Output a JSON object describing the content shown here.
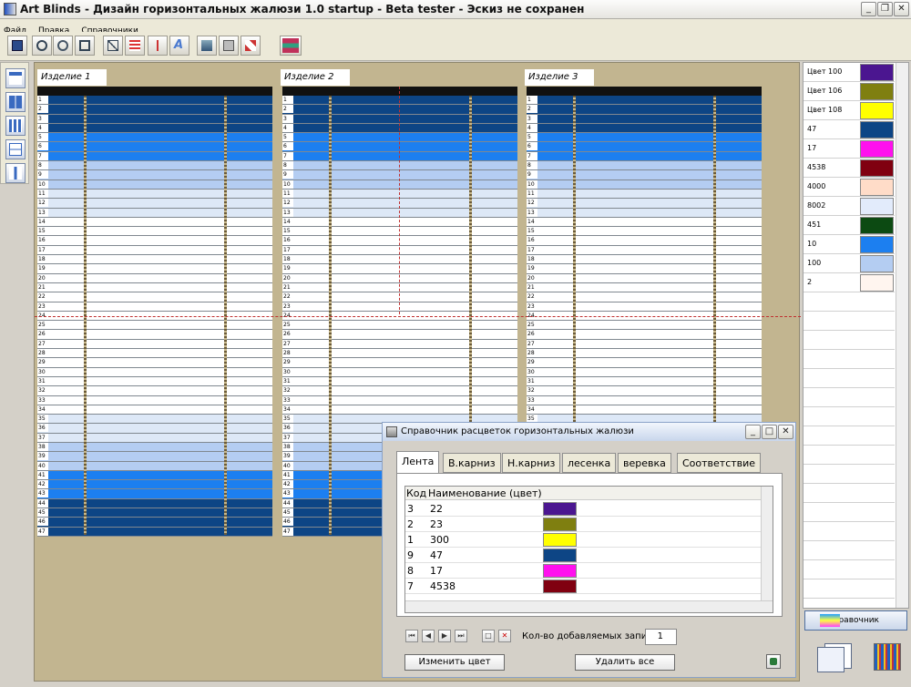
{
  "window": {
    "title": "Art Blinds - Дизайн горизонтальных жалюзи 1.0 startup  -  Beta tester - Эскиз не сохранен"
  },
  "menu": [
    "Файл",
    "Правка",
    "Справочники"
  ],
  "products": [
    {
      "label": "Изделие 1"
    },
    {
      "label": "Изделие 2"
    },
    {
      "label": "Изделие 3"
    }
  ],
  "slat_numbers": [
    "1",
    "2",
    "3",
    "4",
    "5",
    "6",
    "7",
    "8",
    "9",
    "10",
    "11",
    "12",
    "13",
    "14",
    "15",
    "16",
    "17",
    "18",
    "19",
    "20",
    "21",
    "22",
    "23",
    "24",
    "25",
    "26",
    "27",
    "28",
    "29",
    "30",
    "31",
    "32",
    "33",
    "34",
    "35",
    "36",
    "37",
    "38",
    "39",
    "40",
    "41",
    "42",
    "43",
    "44",
    "45",
    "46",
    "47"
  ],
  "colors": {
    "dark_blue": "#0d4585",
    "blue": "#1c7ff0",
    "light_blue": "#b4cdf2",
    "pale_blue": "#dde8f7",
    "white": "#ffffff"
  },
  "palette": [
    {
      "label": "Цвет 100",
      "color": "#4b1690"
    },
    {
      "label": "Цвет 106",
      "color": "#7f7f10"
    },
    {
      "label": "Цвет 108",
      "color": "#ffff00"
    },
    {
      "label": "47",
      "color": "#0d4585"
    },
    {
      "label": "17",
      "color": "#ff10ee"
    },
    {
      "label": "4538",
      "color": "#800010"
    },
    {
      "label": "4000",
      "color": "#ffdcc8"
    },
    {
      "label": "8002",
      "color": "#e2ebfb"
    },
    {
      "label": "451",
      "color": "#0c4a12"
    },
    {
      "label": "10",
      "color": "#1c7ff0"
    },
    {
      "label": "100",
      "color": "#b4cdf2"
    },
    {
      "label": "2",
      "color": "#fff5ef"
    }
  ],
  "ref_button": {
    "label": "Справочник"
  },
  "dialog": {
    "title": "Справочник расцветок горизонтальных жалюзи",
    "tabs": [
      "Лента",
      "В.карниз",
      "Н.карниз",
      "лесенка",
      "веревка",
      "Соответствие"
    ],
    "columns": [
      "Код",
      "Наименование (цвет)"
    ],
    "rows": [
      {
        "code": "3",
        "name": "22",
        "color": "#4b1690"
      },
      {
        "code": "2",
        "name": "23",
        "color": "#7f7f10"
      },
      {
        "code": "1",
        "name": "300",
        "color": "#ffff00"
      },
      {
        "code": "9",
        "name": "47",
        "color": "#0d4585"
      },
      {
        "code": "8",
        "name": "17",
        "color": "#ff10ee"
      },
      {
        "code": "7",
        "name": "4538",
        "color": "#800010"
      }
    ],
    "records_label": "Кол-во добавляемых записей",
    "records_value": "1",
    "change_color_label": "Изменить цвет",
    "delete_all_label": "Удалить все"
  }
}
